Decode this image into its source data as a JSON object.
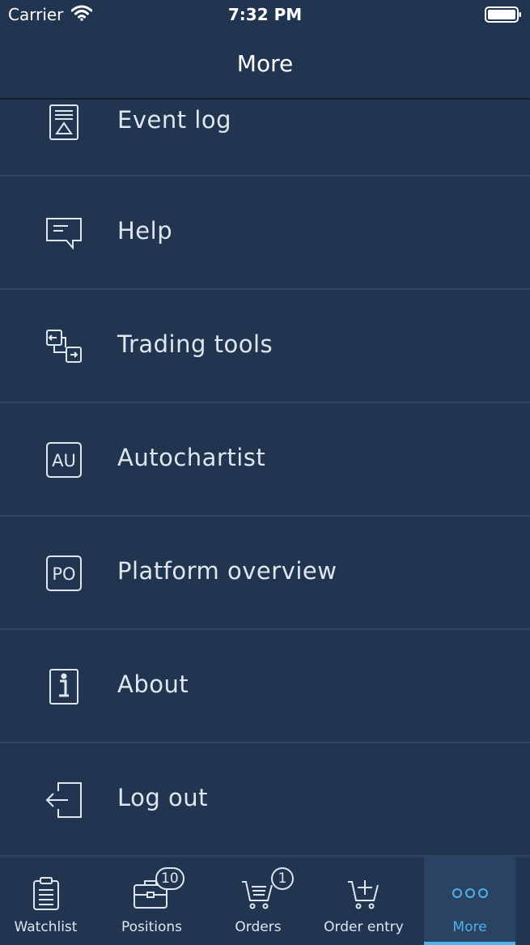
{
  "status_bar": {
    "carrier": "Carrier",
    "time": "7:32 PM"
  },
  "nav": {
    "title": "More"
  },
  "menu": {
    "items": [
      {
        "label": "Event log",
        "icon": "event-log-icon"
      },
      {
        "label": "Help",
        "icon": "help-chat-icon"
      },
      {
        "label": "Trading tools",
        "icon": "trading-tools-icon"
      },
      {
        "label": "Autochartist",
        "icon": "autochartist-icon",
        "icon_text": "AU"
      },
      {
        "label": "Platform overview",
        "icon": "platform-overview-icon",
        "icon_text": "PO"
      },
      {
        "label": "About",
        "icon": "info-icon"
      },
      {
        "label": "Log out",
        "icon": "logout-icon"
      }
    ]
  },
  "tabbar": {
    "accent": "#4fb1ec",
    "tabs": [
      {
        "label": "Watchlist",
        "icon": "clipboard-icon"
      },
      {
        "label": "Positions",
        "icon": "briefcase-icon",
        "badge": "10"
      },
      {
        "label": "Orders",
        "icon": "cart-list-icon",
        "badge": "1"
      },
      {
        "label": "Order entry",
        "icon": "cart-plus-icon"
      },
      {
        "label": "More",
        "icon": "more-dots-icon",
        "active": true
      }
    ]
  }
}
